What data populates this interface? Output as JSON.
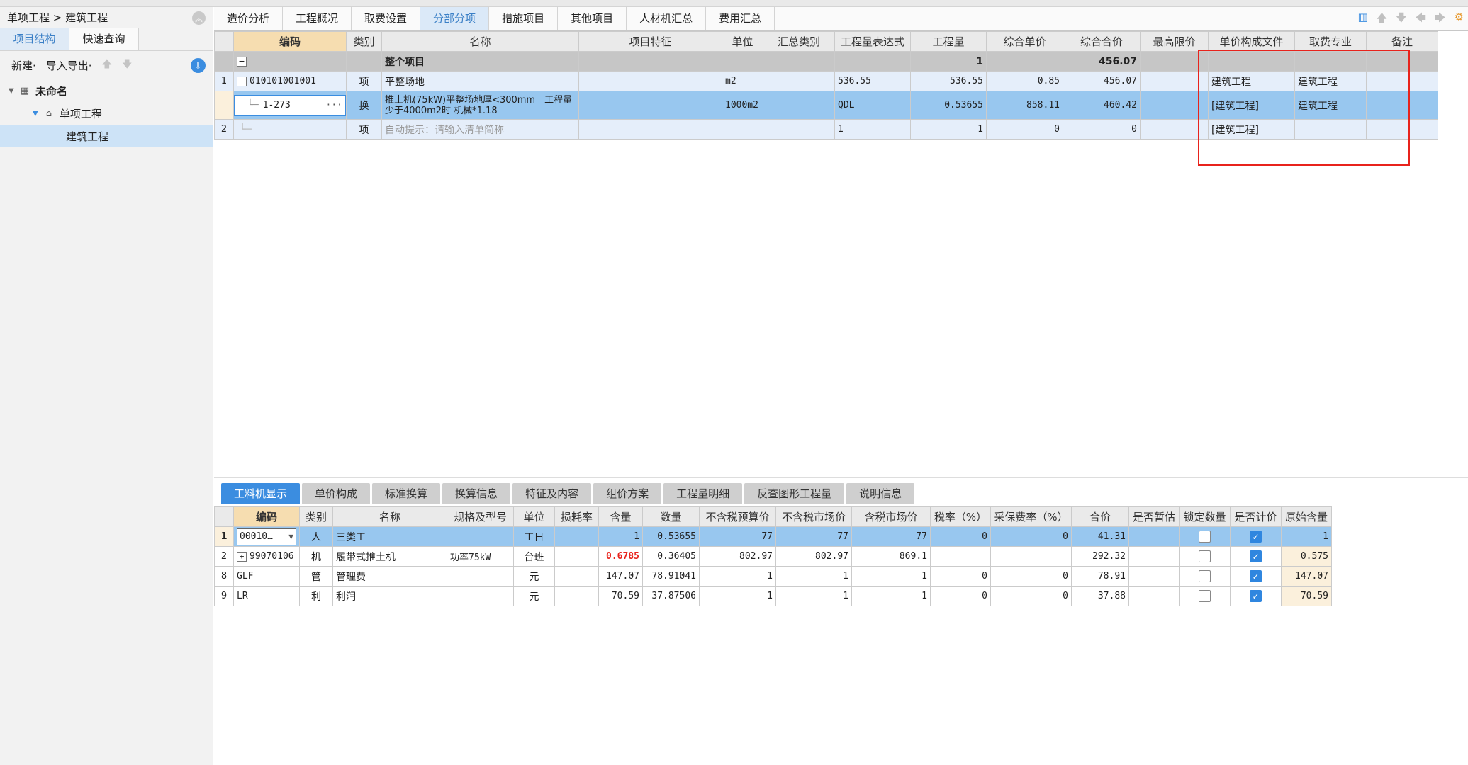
{
  "breadcrumb": "单项工程 > 建筑工程",
  "left": {
    "tabs": [
      "项目结构",
      "快速查询"
    ],
    "new_label": "新建·",
    "import_label": "导入导出·",
    "tree": {
      "root": "未命名",
      "child": "单项工程",
      "leaf": "建筑工程"
    }
  },
  "tabs": [
    "造价分析",
    "工程概况",
    "取费设置",
    "分部分项",
    "措施项目",
    "其他项目",
    "人材机汇总",
    "费用汇总"
  ],
  "main": {
    "headers": [
      "编码",
      "类别",
      "名称",
      "项目特征",
      "单位",
      "汇总类别",
      "工程量表达式",
      "工程量",
      "综合单价",
      "综合合价",
      "最高限价",
      "单价构成文件",
      "取费专业",
      "备注"
    ],
    "total": {
      "name": "整个项目",
      "qty": "1",
      "amount": "456.07"
    },
    "row1": {
      "num": "1",
      "code": "010101001001",
      "type": "项",
      "name": "平整场地",
      "unit": "m2",
      "expr": "536.55",
      "qty": "536.55",
      "price": "0.85",
      "amount": "456.07",
      "file": "建筑工程",
      "major": "建筑工程"
    },
    "row2": {
      "code": "1-273",
      "type": "换",
      "name": "推土机(75kW)平整场地厚<300mm　工程量少于4000m2时 机械*1.18",
      "unit": "1000m2",
      "expr": "QDL",
      "qty": "0.53655",
      "price": "858.11",
      "amount": "460.42",
      "file": "[建筑工程]",
      "major": "建筑工程"
    },
    "row3": {
      "num": "2",
      "type": "项",
      "name": "自动提示：请输入清单简称",
      "expr": "1",
      "qty": "1",
      "price": "0",
      "amount": "0",
      "file": "[建筑工程]"
    }
  },
  "bottom": {
    "tabs": [
      "工料机显示",
      "单价构成",
      "标准换算",
      "换算信息",
      "特征及内容",
      "组价方案",
      "工程量明细",
      "反查图形工程量",
      "说明信息"
    ],
    "headers": [
      "编码",
      "类别",
      "名称",
      "规格及型号",
      "单位",
      "损耗率",
      "含量",
      "数量",
      "不含税预算价",
      "不含税市场价",
      "含税市场价",
      "税率（%）",
      "采保费率（%）",
      "合价",
      "是否暂估",
      "锁定数量",
      "是否计价",
      "原始含量"
    ],
    "rows": [
      {
        "num": "1",
        "code": "00010…",
        "type": "人",
        "name": "三类工",
        "spec": "",
        "unit": "工日",
        "loss": "",
        "content": "1",
        "qty": "0.53655",
        "p1": "77",
        "p2": "77",
        "p3": "77",
        "tax": "0",
        "fee": "0",
        "sum": "41.31",
        "orig": "1"
      },
      {
        "num": "2",
        "code": "99070106",
        "type": "机",
        "name": "履带式推土机",
        "spec": "功率75kW",
        "unit": "台班",
        "loss": "",
        "content": "0.6785",
        "qty": "0.36405",
        "p1": "802.97",
        "p2": "802.97",
        "p3": "869.1",
        "tax": "",
        "fee": "",
        "sum": "292.32",
        "orig": "0.575"
      },
      {
        "num": "8",
        "code": "GLF",
        "type": "管",
        "name": "管理费",
        "spec": "",
        "unit": "元",
        "loss": "",
        "content": "147.07",
        "qty": "78.91041",
        "p1": "1",
        "p2": "1",
        "p3": "1",
        "tax": "0",
        "fee": "0",
        "sum": "78.91",
        "orig": "147.07"
      },
      {
        "num": "9",
        "code": "LR",
        "type": "利",
        "name": "利润",
        "spec": "",
        "unit": "元",
        "loss": "",
        "content": "70.59",
        "qty": "37.87506",
        "p1": "1",
        "p2": "1",
        "p3": "1",
        "tax": "0",
        "fee": "0",
        "sum": "37.88",
        "orig": "70.59"
      }
    ]
  },
  "colors": {
    "accent": "#3b8de0",
    "selected_row": "#98c7ef",
    "highlight_box": "#e8231c"
  }
}
